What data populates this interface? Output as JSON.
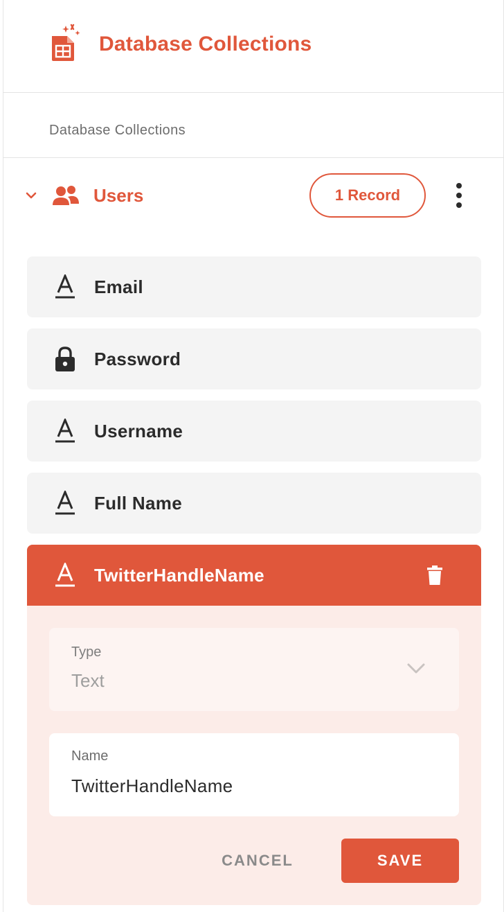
{
  "colors": {
    "accent": "#e0573b",
    "accent_light": "#fcece8",
    "row_bg": "#f4f4f4",
    "text": "#2b2b2b"
  },
  "header": {
    "title": "Database Collections",
    "icon": "database-sheet-icon"
  },
  "section": {
    "label": "Database Collections"
  },
  "collection": {
    "name": "Users",
    "icon": "users-icon",
    "badge": "1 Record",
    "expanded": true
  },
  "fields": [
    {
      "label": "Email",
      "icon": "text-type-icon"
    },
    {
      "label": "Password",
      "icon": "lock-icon"
    },
    {
      "label": "Username",
      "icon": "text-type-icon"
    },
    {
      "label": "Full Name",
      "icon": "text-type-icon"
    }
  ],
  "active_field": {
    "label": "TwitterHandleName",
    "icon": "text-type-icon",
    "type_label": "Type",
    "type_value": "Text",
    "name_label": "Name",
    "name_value": "TwitterHandleName",
    "cancel_label": "CANCEL",
    "save_label": "SAVE"
  }
}
